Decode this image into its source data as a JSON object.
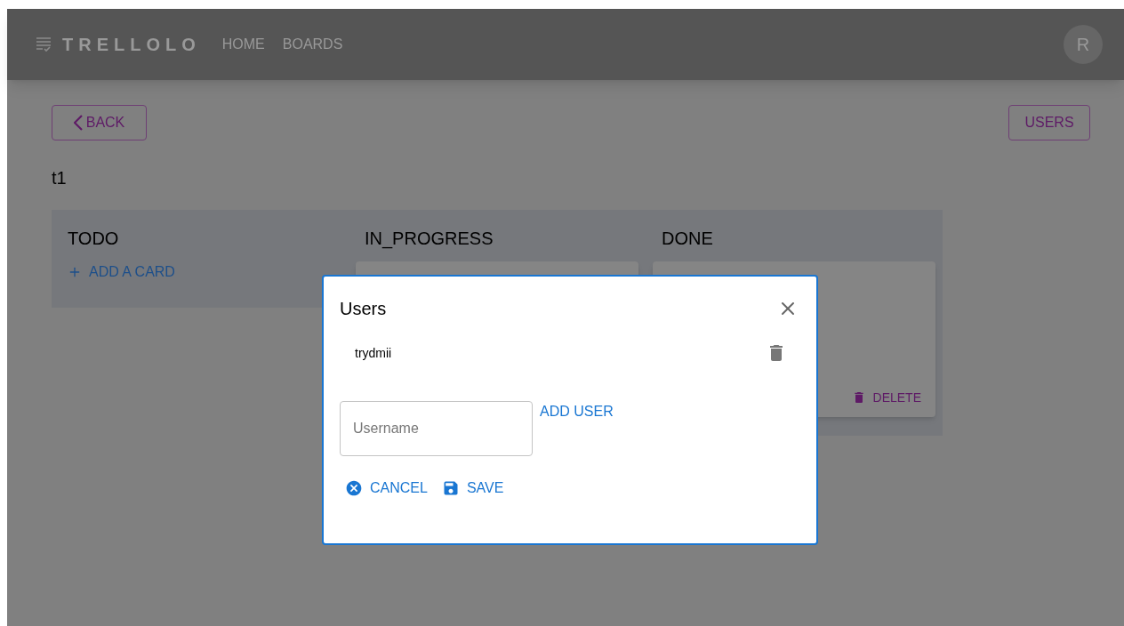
{
  "header": {
    "logo": "TRELLOLO",
    "nav": [
      {
        "label": "HOME"
      },
      {
        "label": "BOARDS"
      }
    ],
    "avatar": "R"
  },
  "toolbar": {
    "back": "BACK",
    "users": "USERS"
  },
  "board": {
    "title": "t1",
    "columns": [
      {
        "title": "TODO",
        "add_card": "ADD A CARD"
      },
      {
        "title": "IN_PROGRESS",
        "cards": [
          {
            "kind": "blank"
          }
        ]
      },
      {
        "title": "DONE",
        "cards": [
          {
            "kind": "deletable",
            "delete": "DELETE"
          }
        ]
      }
    ]
  },
  "dialog": {
    "title": "Users",
    "users": [
      {
        "name": "trydmii"
      }
    ],
    "username": {
      "placeholder": "Username"
    },
    "add_user": "ADD USER",
    "cancel": "CANCEL",
    "save": "SAVE"
  }
}
